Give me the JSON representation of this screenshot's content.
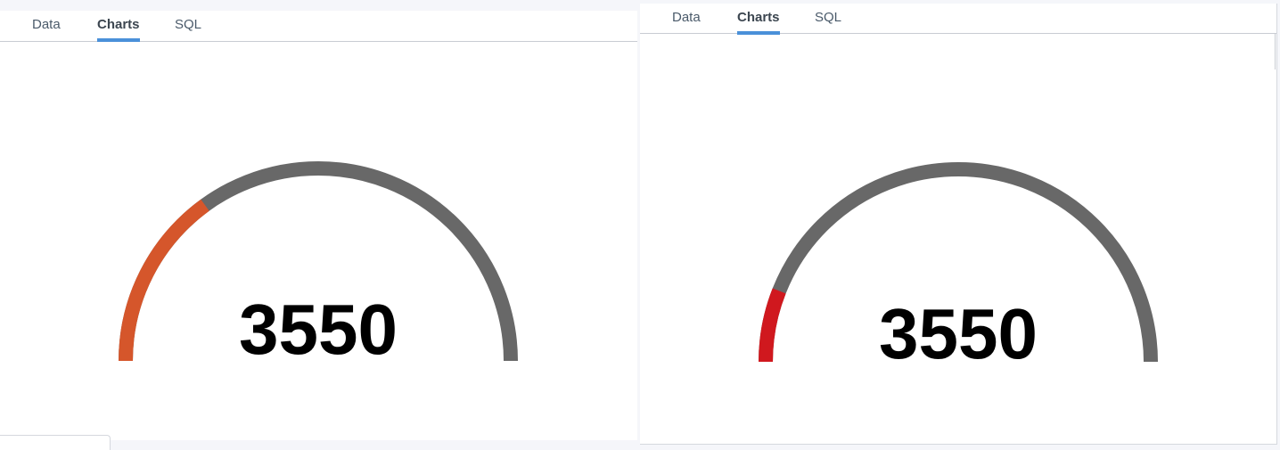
{
  "panels": [
    {
      "tabs": [
        {
          "label": "Data",
          "active": false
        },
        {
          "label": "Charts",
          "active": true
        },
        {
          "label": "SQL",
          "active": false
        }
      ],
      "gauge": {
        "value_label": "3550",
        "fill_fraction": 0.3,
        "fill_color": "#d5562b",
        "track_color": "#686868"
      }
    },
    {
      "tabs": [
        {
          "label": "Data",
          "active": false
        },
        {
          "label": "Charts",
          "active": true
        },
        {
          "label": "SQL",
          "active": false
        }
      ],
      "gauge": {
        "value_label": "3550",
        "fill_fraction": 0.12,
        "fill_color": "#d0181e",
        "track_color": "#686868"
      }
    }
  ]
}
